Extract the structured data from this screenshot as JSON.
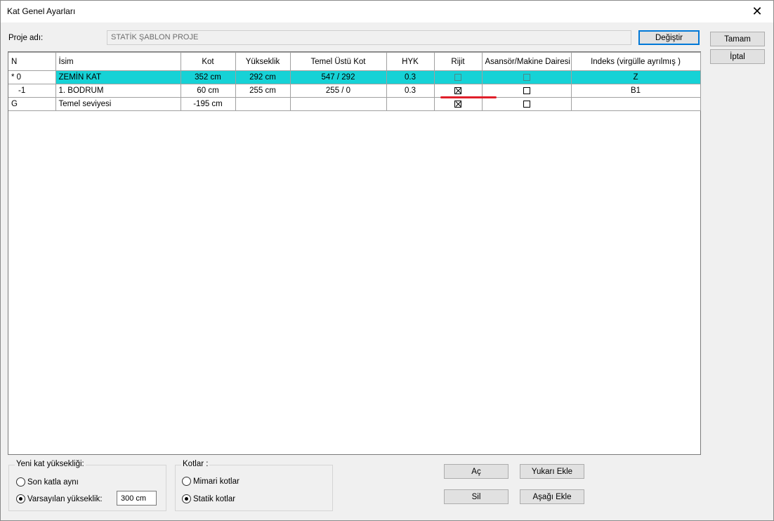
{
  "window": {
    "title": "Kat Genel Ayarları"
  },
  "project": {
    "label": "Proje adı:",
    "value": "STATİK ŞABLON PROJE",
    "change_button": "Değiştir"
  },
  "dialog_buttons": {
    "ok": "Tamam",
    "cancel": "İptal"
  },
  "table": {
    "columns": [
      "N",
      "İsim",
      "Kot",
      "Yükseklik",
      "Temel Üstü Kot",
      "HYK",
      "Rijit",
      "Asansör/Makine Dairesi",
      "Indeks (virgülle ayrılmış )"
    ],
    "rows": [
      {
        "n": "* 0",
        "name": "ZEMİN KAT",
        "kot": "352 cm",
        "height": "292 cm",
        "foundation": "547 / 292",
        "hyk": "0.3",
        "rigid": false,
        "elevator": false,
        "index": "Z",
        "selected": true
      },
      {
        "n": "-1",
        "name": "1. BODRUM",
        "kot": "60 cm",
        "height": "255 cm",
        "foundation": "255 / 0",
        "hyk": "0.3",
        "rigid": true,
        "elevator": false,
        "index": "B1",
        "selected": false
      },
      {
        "n": "G",
        "name": "Temel seviyesi",
        "kot": "-195 cm",
        "height": "",
        "foundation": "",
        "hyk": "",
        "rigid": true,
        "elevator": false,
        "index": "",
        "selected": false
      }
    ]
  },
  "new_floor_height": {
    "title": "Yeni kat yüksekliği:",
    "option_same": "Son katla aynı",
    "option_default": "Varsayılan yükseklik:",
    "selected": "default",
    "default_value": "300 cm"
  },
  "elevations": {
    "title": "Kotlar :",
    "option_arch": "Mimari kotlar",
    "option_static": "Statik kotlar",
    "selected": "static"
  },
  "action_buttons": {
    "open": "Aç",
    "delete": "Sil",
    "add_above": "Yukarı Ekle",
    "add_below": "Aşağı Ekle"
  },
  "colors": {
    "selected_row": "#16d2d6",
    "annotation": "#e01f2a",
    "default_button_border": "#0078d7"
  }
}
